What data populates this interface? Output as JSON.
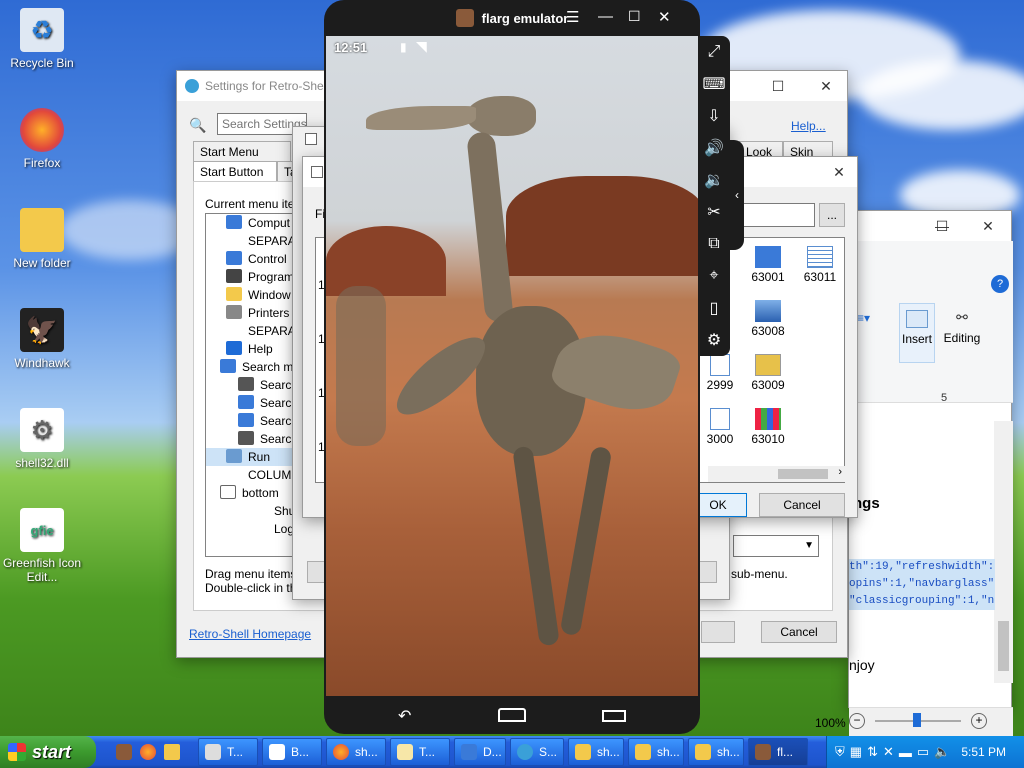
{
  "desktop": {
    "icons": [
      {
        "label": "Recycle Bin",
        "icon": "recycle-bin-icon"
      },
      {
        "label": "Firefox",
        "icon": "firefox-icon"
      },
      {
        "label": "New folder",
        "icon": "folder-icon"
      },
      {
        "label": "Windhawk",
        "icon": "windhawk-icon"
      },
      {
        "label": "shell32.dll",
        "icon": "dll-gear-icon"
      },
      {
        "label": "Greenfish Icon Edit...",
        "icon": "greenfish-icon"
      }
    ]
  },
  "settings": {
    "title": "Settings for Retro-Shell",
    "search_placeholder": "Search Settings",
    "help_link": "Help...",
    "tabs": [
      "Start Menu Style",
      "Start Button",
      "Ta",
      "Look",
      "Skin"
    ],
    "current_menu_label": "Current menu ite",
    "tree": [
      "Comput",
      "SEPARAT",
      "Control",
      "Program",
      "Window",
      "Printers",
      "SEPARAT",
      "Help",
      "Search m",
      "Search",
      "Search",
      "Search",
      "Search",
      "Run",
      "COLUMN",
      "bottom",
      "Shut",
      "Log"
    ],
    "hint1": "Drag menu items",
    "hint2": "Double-click in th",
    "homepage": "Retro-Shell Homepage",
    "sub_menu": "sub-menu.",
    "cancel": "Cancel"
  },
  "filedialog": {
    "label_fi": "Fi",
    "nums": [
      "16",
      "16",
      "16",
      "16"
    ],
    "icons": [
      "63001",
      "63011",
      "63008",
      "2999",
      "63009",
      "3000",
      "63010"
    ],
    "ok": "OK",
    "cancel": "Cancel",
    "browse": "..."
  },
  "wordpad": {
    "insert": "Insert",
    "editing": "Editing",
    "ruler_5": "5",
    "heading": "ngs",
    "code1": "th\":19,\"refreshwidth\":25,\"",
    "code2": "opins\":1,\"navbarglass\":0,\"n",
    "code3": "\"classicgrouping\":1,\"nopcfo",
    "enjoy": "njoy",
    "zoom": "100%"
  },
  "emulator": {
    "title": "flarg emulator",
    "time": "12:51"
  },
  "taskbar": {
    "start": "start",
    "items": [
      "T...",
      "B...",
      "sh...",
      "T...",
      "D...",
      "S...",
      "sh...",
      "sh...",
      "sh...",
      "fl..."
    ],
    "clock": "5:51 PM"
  },
  "colors": {
    "accent": "#0a5ad6",
    "start_green": "#3c9a2e"
  }
}
